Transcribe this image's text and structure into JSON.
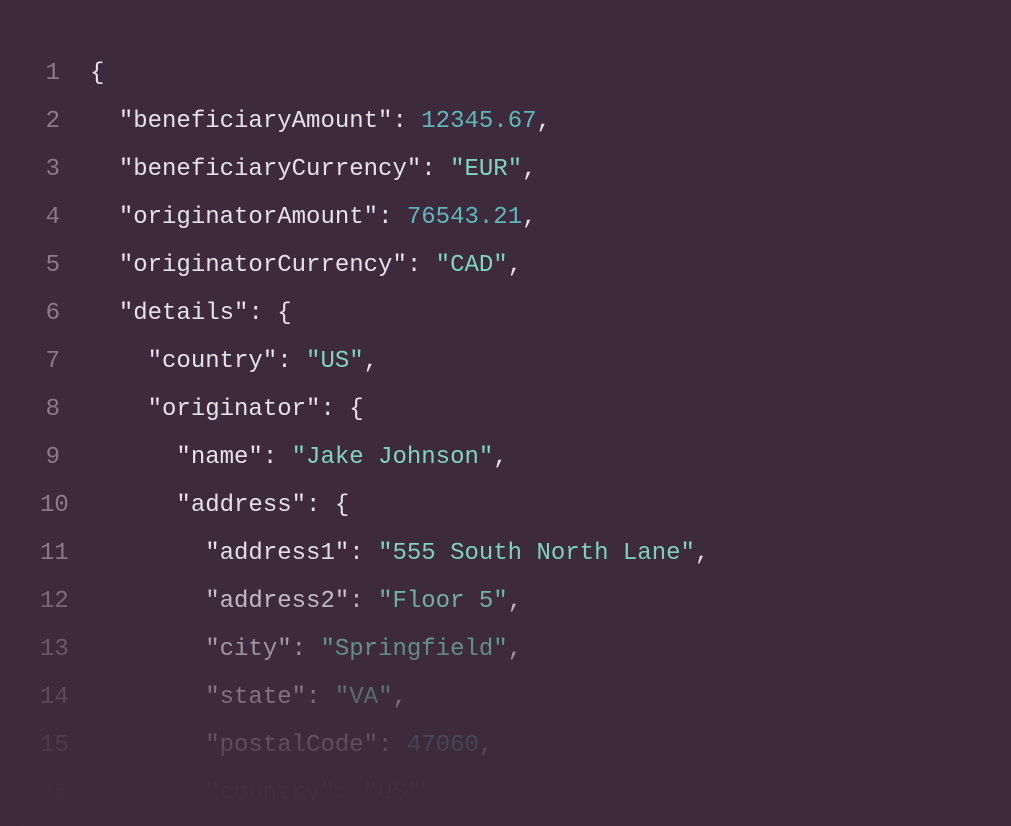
{
  "code": {
    "lines": [
      {
        "num": "1",
        "tokens": [
          {
            "text": "{",
            "type": "punct"
          }
        ]
      },
      {
        "num": "2",
        "tokens": [
          {
            "text": "  ",
            "type": "punct"
          },
          {
            "text": "\"beneficiaryAmount\"",
            "type": "key"
          },
          {
            "text": ": ",
            "type": "punct"
          },
          {
            "text": "12345.67",
            "type": "number"
          },
          {
            "text": ",",
            "type": "punct"
          }
        ]
      },
      {
        "num": "3",
        "tokens": [
          {
            "text": "  ",
            "type": "punct"
          },
          {
            "text": "\"beneficiaryCurrency\"",
            "type": "key"
          },
          {
            "text": ": ",
            "type": "punct"
          },
          {
            "text": "\"EUR\"",
            "type": "string"
          },
          {
            "text": ",",
            "type": "punct"
          }
        ]
      },
      {
        "num": "4",
        "tokens": [
          {
            "text": "  ",
            "type": "punct"
          },
          {
            "text": "\"originatorAmount\"",
            "type": "key"
          },
          {
            "text": ": ",
            "type": "punct"
          },
          {
            "text": "76543.21",
            "type": "number"
          },
          {
            "text": ",",
            "type": "punct"
          }
        ]
      },
      {
        "num": "5",
        "tokens": [
          {
            "text": "  ",
            "type": "punct"
          },
          {
            "text": "\"originatorCurrency\"",
            "type": "key"
          },
          {
            "text": ": ",
            "type": "punct"
          },
          {
            "text": "\"CAD\"",
            "type": "string"
          },
          {
            "text": ",",
            "type": "punct"
          }
        ]
      },
      {
        "num": "6",
        "tokens": [
          {
            "text": "  ",
            "type": "punct"
          },
          {
            "text": "\"details\"",
            "type": "key"
          },
          {
            "text": ": {",
            "type": "punct"
          }
        ]
      },
      {
        "num": "7",
        "tokens": [
          {
            "text": "    ",
            "type": "punct"
          },
          {
            "text": "\"country\"",
            "type": "key"
          },
          {
            "text": ": ",
            "type": "punct"
          },
          {
            "text": "\"US\"",
            "type": "string"
          },
          {
            "text": ",",
            "type": "punct"
          }
        ]
      },
      {
        "num": "8",
        "tokens": [
          {
            "text": "    ",
            "type": "punct"
          },
          {
            "text": "\"originator\"",
            "type": "key"
          },
          {
            "text": ": {",
            "type": "punct"
          }
        ]
      },
      {
        "num": "9",
        "tokens": [
          {
            "text": "      ",
            "type": "punct"
          },
          {
            "text": "\"name\"",
            "type": "key"
          },
          {
            "text": ": ",
            "type": "punct"
          },
          {
            "text": "\"Jake Johnson\"",
            "type": "string"
          },
          {
            "text": ",",
            "type": "punct"
          }
        ]
      },
      {
        "num": "10",
        "tokens": [
          {
            "text": "      ",
            "type": "punct"
          },
          {
            "text": "\"address\"",
            "type": "key"
          },
          {
            "text": ": {",
            "type": "punct"
          }
        ]
      },
      {
        "num": "11",
        "tokens": [
          {
            "text": "        ",
            "type": "punct"
          },
          {
            "text": "\"address1\"",
            "type": "key"
          },
          {
            "text": ": ",
            "type": "punct"
          },
          {
            "text": "\"555 South North Lane\"",
            "type": "string"
          },
          {
            "text": ",",
            "type": "punct"
          }
        ]
      },
      {
        "num": "12",
        "tokens": [
          {
            "text": "        ",
            "type": "punct"
          },
          {
            "text": "\"address2\"",
            "type": "key"
          },
          {
            "text": ": ",
            "type": "punct"
          },
          {
            "text": "\"Floor 5\"",
            "type": "string"
          },
          {
            "text": ",",
            "type": "punct"
          }
        ]
      },
      {
        "num": "13",
        "tokens": [
          {
            "text": "        ",
            "type": "punct"
          },
          {
            "text": "\"city\"",
            "type": "key"
          },
          {
            "text": ": ",
            "type": "punct"
          },
          {
            "text": "\"Springfield\"",
            "type": "string"
          },
          {
            "text": ",",
            "type": "punct"
          }
        ]
      },
      {
        "num": "14",
        "tokens": [
          {
            "text": "        ",
            "type": "punct"
          },
          {
            "text": "\"state\"",
            "type": "key"
          },
          {
            "text": ": ",
            "type": "punct"
          },
          {
            "text": "\"VA\"",
            "type": "string"
          },
          {
            "text": ",",
            "type": "punct"
          }
        ]
      },
      {
        "num": "15",
        "tokens": [
          {
            "text": "        ",
            "type": "punct"
          },
          {
            "text": "\"postalCode\"",
            "type": "key"
          },
          {
            "text": ": ",
            "type": "punct"
          },
          {
            "text": "47060",
            "type": "number"
          },
          {
            "text": ",",
            "type": "punct"
          }
        ]
      },
      {
        "num": "16",
        "tokens": [
          {
            "text": "        ",
            "type": "punct"
          },
          {
            "text": "\"country\"",
            "type": "key"
          },
          {
            "text": ": ",
            "type": "punct"
          },
          {
            "text": "\"US\"",
            "type": "string"
          }
        ]
      }
    ]
  },
  "chart_data": {
    "type": "json-document",
    "content": {
      "beneficiaryAmount": 12345.67,
      "beneficiaryCurrency": "EUR",
      "originatorAmount": 76543.21,
      "originatorCurrency": "CAD",
      "details": {
        "country": "US",
        "originator": {
          "name": "Jake Johnson",
          "address": {
            "address1": "555 South North Lane",
            "address2": "Floor 5",
            "city": "Springfield",
            "state": "VA",
            "postalCode": 47060,
            "country": "US"
          }
        }
      }
    }
  }
}
